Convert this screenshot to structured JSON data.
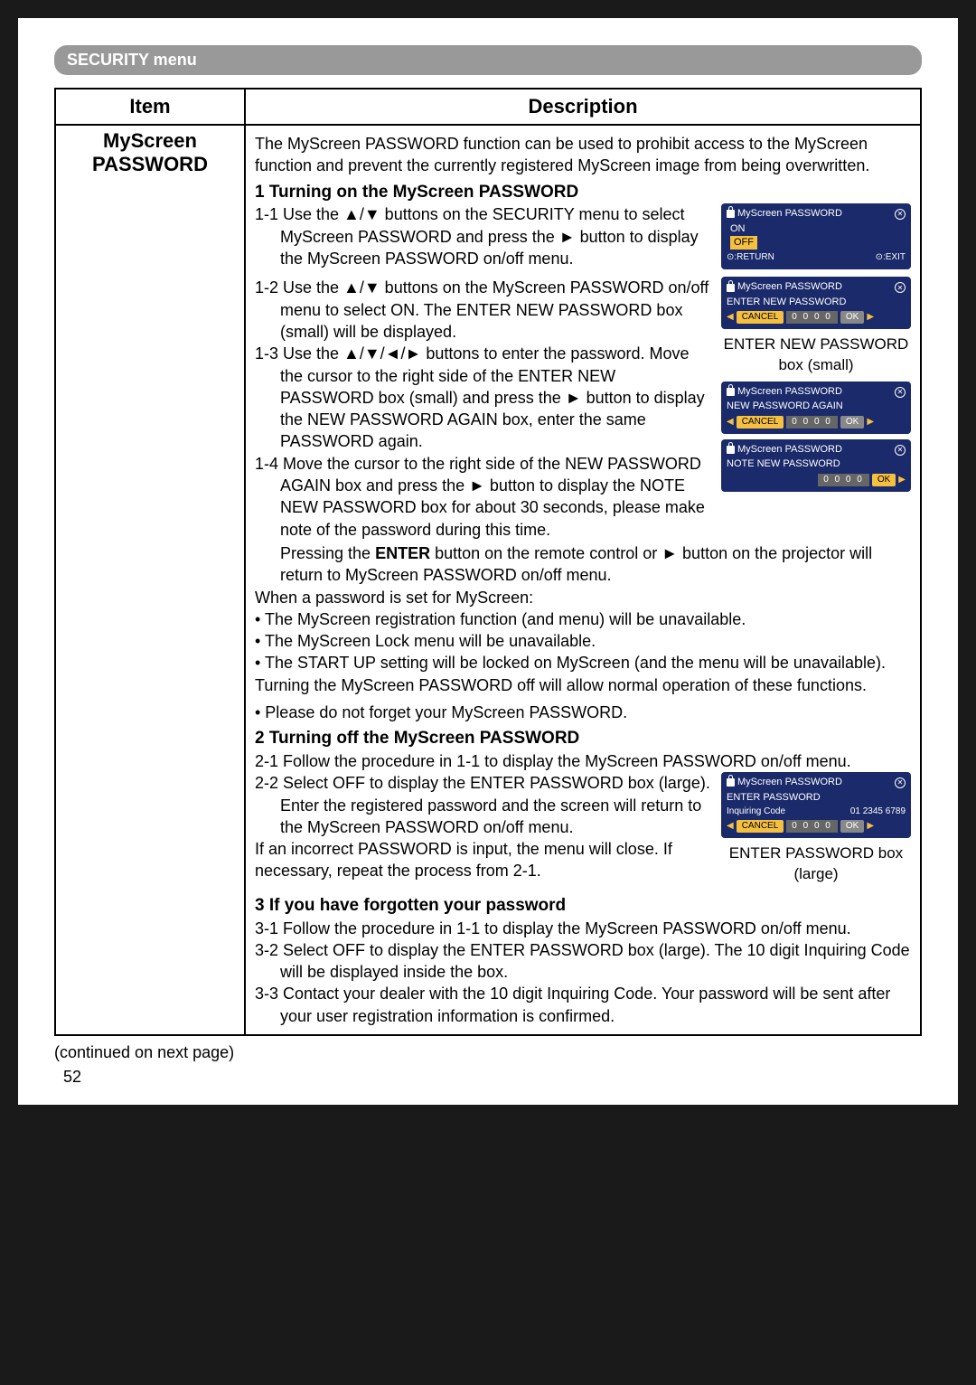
{
  "header": {
    "menu_title": "SECURITY menu"
  },
  "table": {
    "col_item": "Item",
    "col_desc": "Description",
    "item_name": "MyScreen PASSWORD"
  },
  "intro": "The MyScreen PASSWORD function can be used to prohibit access to the MyScreen function and prevent the currently registered MyScreen image from being overwritten.",
  "h1": "1 Turning on the MyScreen PASSWORD",
  "s1_1": "1-1 Use the ▲/▼ buttons on the SECURITY menu to select MyScreen PASSWORD and press the ► button to display the MyScreen PASSWORD on/off menu.",
  "s1_2": "1-2 Use the ▲/▼ buttons on the MyScreen PASSWORD on/off menu to select ON. The ENTER NEW PASSWORD box (small) will be displayed.",
  "s1_3": "1-3 Use the ▲/▼/◄/► buttons to enter the password. Move the cursor to the right side of the ENTER NEW PASSWORD box (small) and press the ► button to display the NEW PASSWORD AGAIN box, enter the same PASSWORD again.",
  "s1_4": "1-4 Move the cursor to the right side of the NEW PASSWORD AGAIN box and press the ► button to display the NOTE NEW PASSWORD box for about 30 seconds, please make note of the password during this time.",
  "s1_end": "Pressing the ENTER button on the remote control or ► button on the projector will return to MyScreen PASSWORD on/off menu.",
  "when_set_intro": "When a password is set for MyScreen:",
  "bul1": "• The MyScreen registration function (and menu) will be unavailable.",
  "bul2": "• The MyScreen Lock menu will be unavailable.",
  "bul3": "• The START UP setting will be locked on MyScreen (and the menu will be unavailable).",
  "when_off": "Turning the MyScreen PASSWORD off will allow normal operation of these functions.",
  "note": "• Please do not forget your MyScreen PASSWORD.",
  "h2": "2 Turning off the MyScreen PASSWORD",
  "s2_1": "2-1 Follow the procedure in 1-1 to display the MyScreen PASSWORD on/off menu.",
  "s2_2": "2-2 Select OFF to display the ENTER PASSWORD box (large). Enter the registered password and the screen will return to the MyScreen PASSWORD on/off menu.",
  "s2_end": "If an incorrect PASSWORD is input, the menu will close. If necessary, repeat the process from 2-1.",
  "h3": "3 If you have forgotten your password",
  "s3_1": "3-1 Follow the procedure in 1-1 to display the MyScreen PASSWORD on/off menu.",
  "s3_2": "3-2 Select OFF to display the ENTER PASSWORD box (large). The 10 digit Inquiring Code will be displayed inside the box.",
  "s3_3": "3-3 Contact your dealer with the 10 digit Inquiring Code. Your password will be sent after your user registration information is confirmed.",
  "continued": "(continued on next page)",
  "page_number": "52",
  "osd": {
    "title": "MyScreen PASSWORD",
    "on": "ON",
    "off": "OFF",
    "return": "⊙:RETURN",
    "exit": "⊙:EXIT",
    "enter_new": "ENTER NEW PASSWORD",
    "new_again": "NEW PASSWORD AGAIN",
    "note_new": "NOTE NEW PASSWORD",
    "enter_pw": "ENTER PASSWORD",
    "inq": "Inquiring Code",
    "inq_val": "01 2345 6789",
    "cancel": "CANCEL",
    "ok": "OK",
    "digits": "0 0 0 0"
  },
  "captions": {
    "c2": "ENTER NEW PASSWORD box (small)",
    "c5": "ENTER PASSWORD box (large)"
  }
}
